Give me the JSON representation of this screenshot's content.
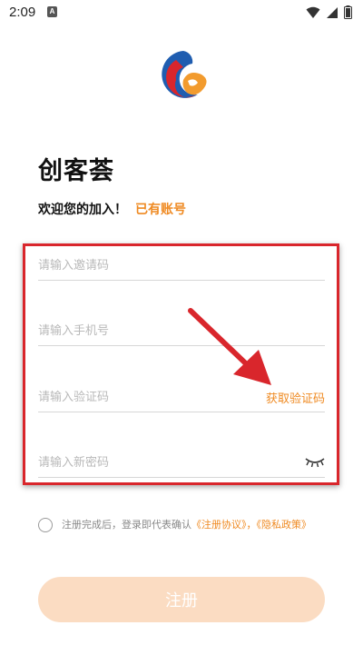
{
  "status_bar": {
    "time": "2:09",
    "notification_icon": "A",
    "icons": [
      "wifi-icon",
      "signal-icon",
      "battery-icon"
    ]
  },
  "app": {
    "logo_icon": "app-logo-icon",
    "name": "创客荟",
    "welcome": "欢迎您的加入！",
    "has_account_link": "已有账号"
  },
  "form": {
    "invite_code": {
      "placeholder": "请输入邀请码",
      "value": ""
    },
    "phone": {
      "placeholder": "请输入手机号",
      "value": ""
    },
    "verify_code": {
      "placeholder": "请输入验证码",
      "value": ""
    },
    "get_code_label": "获取验证码",
    "new_password": {
      "placeholder": "请输入新密码",
      "value": ""
    },
    "password_toggle_icon": "eye-closed-icon"
  },
  "agreement": {
    "checked": false,
    "prefix": "注册完成后，登录即代表确认",
    "terms_link": "《注册协议》",
    "separator": "，",
    "privacy_link": "《隐私政策》"
  },
  "register_button_label": "注册",
  "colors": {
    "accent": "#ef8a22",
    "button_disabled": "#fbdcc2",
    "annotation_red": "#d9262c"
  }
}
